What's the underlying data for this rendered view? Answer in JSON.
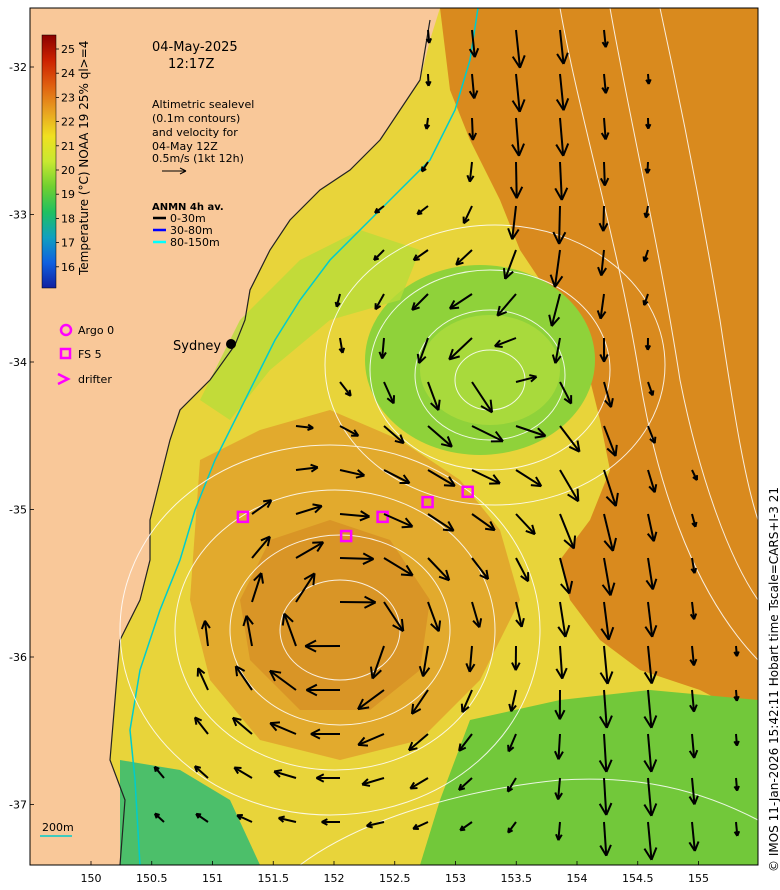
{
  "header": {
    "date": "04-May-2025",
    "time": "12:17Z"
  },
  "altimetry_note": {
    "lines": [
      "Altimetric sealevel",
      "(0.1m contours)",
      "and velocity for",
      "04-May 12Z",
      "0.5m/s (1kt 12h)"
    ]
  },
  "anmn": {
    "title": "ANMN 4h av.",
    "items": [
      {
        "label": "0-30m",
        "color": "#000000"
      },
      {
        "label": "30-80m",
        "color": "#0000ff"
      },
      {
        "label": "80-150m",
        "color": "#00ffff"
      }
    ]
  },
  "legend": {
    "argo": "Argo 0",
    "fs": "FS 5",
    "drifter": "drifter",
    "marker_color": "#ff00ff"
  },
  "city": {
    "name": "Sydney"
  },
  "colorbar": {
    "label": "Temperature (°C) NOAA 19 25% ql>=4",
    "ticks": [
      "25",
      "24",
      "23",
      "22",
      "21",
      "20",
      "19",
      "18",
      "17",
      "16"
    ],
    "stops": [
      "#8b0000",
      "#cc2200",
      "#e06010",
      "#e8a020",
      "#f0e020",
      "#c8e830",
      "#70d030",
      "#20c060",
      "#10a0c0",
      "#1060e0",
      "#1020a0"
    ]
  },
  "isobath": {
    "label": "200m",
    "color": "#00e0e0"
  },
  "axes": {
    "x_ticks": [
      "150",
      "150.5",
      "151",
      "151.5",
      "152",
      "152.5",
      "153",
      "153.5",
      "154",
      "154.5",
      "155"
    ],
    "y_ticks": [
      "-32",
      "-33",
      "-34",
      "-35",
      "-36",
      "-37"
    ]
  },
  "credit": "© IMOS 11-Jan-2026 15:42:11 Hobart time Tscale=CARS+I-3 21",
  "fs_markers": [
    {
      "lon": 151.25,
      "lat": -35.05
    },
    {
      "lon": 152.1,
      "lat": -35.18
    },
    {
      "lon": 152.4,
      "lat": -35.05
    },
    {
      "lon": 152.77,
      "lat": -34.95
    },
    {
      "lon": 153.1,
      "lat": -34.88
    }
  ],
  "colors": {
    "land": "#f9c899",
    "warm": "#d98a1e",
    "cool": "#9bd63a",
    "coast_current": "#00cccc"
  }
}
